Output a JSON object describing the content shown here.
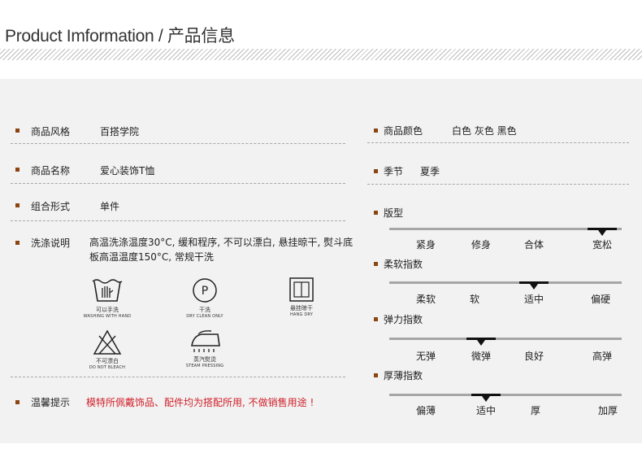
{
  "header": {
    "title": "Product Imformation / 产品信息"
  },
  "left": {
    "rows": [
      {
        "label": "商品风格",
        "value": "百搭学院"
      },
      {
        "label": "商品名称",
        "value": "爱心装饰T恤"
      },
      {
        "label": "组合形式",
        "value": "单件"
      },
      {
        "label": "洗涤说明",
        "value": "高温洗涤温度30°C, 缓和程序, 不可以漂白, 悬挂晾干, 熨斗底板高温温度150°C, 常规干洗"
      }
    ],
    "care_icons": [
      {
        "icon": "hand-wash-icon",
        "cn": "可以手洗",
        "en": "WASHING WITH HAND"
      },
      {
        "icon": "dry-clean-icon",
        "symbol": "P",
        "cn": "干洗",
        "en": "DRY CLEAN ONLY"
      },
      {
        "icon": "hang-dry-icon",
        "cn": "悬挂晾干",
        "en": "HANG DRY"
      },
      {
        "icon": "no-bleach-icon",
        "cn": "不可漂白",
        "en": "DO NOT BLEACH"
      },
      {
        "icon": "steam-iron-icon",
        "cn": "蒸汽熨烫",
        "en": "STEAM PRESSING"
      }
    ],
    "notice": {
      "label": "温馨提示",
      "value": "模特所佩戴饰品、配件均为搭配所用, 不做销售用途 !"
    }
  },
  "right": {
    "rows": [
      {
        "label": "商品颜色",
        "value": "白色  灰色  黑色"
      },
      {
        "label": "季节",
        "value": "夏季"
      }
    ],
    "scales": [
      {
        "label": "版型",
        "ticks": [
          "紧身",
          "修身",
          "合体",
          "宽松"
        ],
        "selected_index": 3
      },
      {
        "label": "柔软指数",
        "ticks": [
          "柔软",
          "软",
          "适中",
          "偏硬"
        ],
        "selected_index": 2
      },
      {
        "label": "弹力指数",
        "ticks": [
          "无弹",
          "微弹",
          "良好",
          "高弹"
        ],
        "selected_index": 1
      },
      {
        "label": "厚薄指数",
        "ticks": [
          "偏薄",
          "适中",
          "厚",
          "加厚"
        ],
        "selected_index": 1
      }
    ]
  },
  "colors": {
    "bullet": "#8b4513",
    "notice": "#d0202a",
    "panel": "#f2f2f2"
  }
}
